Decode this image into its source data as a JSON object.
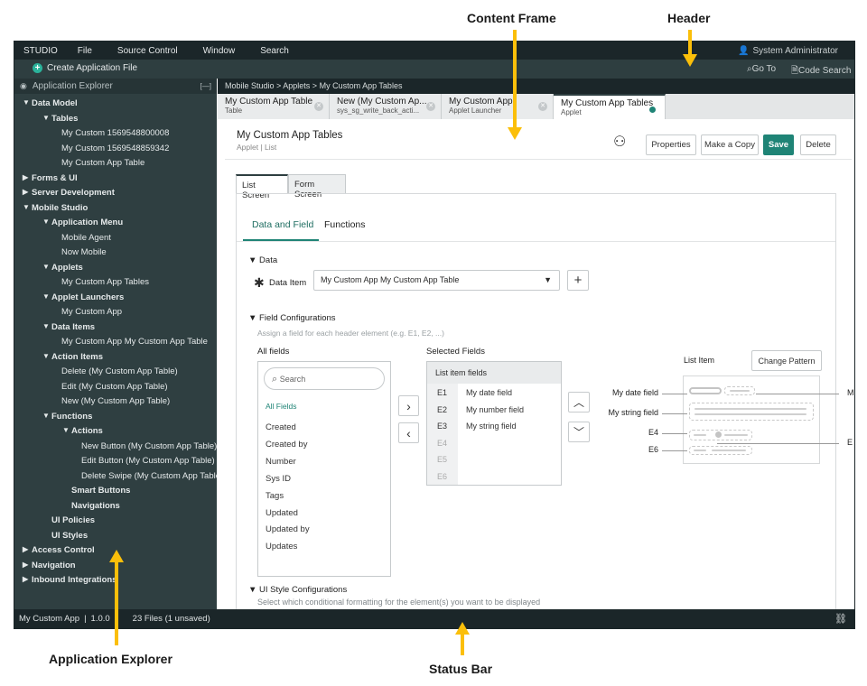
{
  "annotations": {
    "content_frame": "Content Frame",
    "header": "Header",
    "application_explorer": "Application Explorer",
    "status_bar": "Status Bar"
  },
  "menu": {
    "items": [
      "STUDIO",
      "File",
      "Source Control",
      "Window",
      "Search"
    ],
    "user": "System Administrator",
    "create": "Create Application File",
    "goto": "Go To",
    "code_search": "Code Search"
  },
  "explorer": {
    "title": "Application Explorer",
    "collapse": "[—]",
    "items": [
      {
        "label": "Data Model",
        "depth": 0,
        "arrow": "open",
        "bold": true
      },
      {
        "label": "Tables",
        "depth": 2,
        "arrow": "open",
        "bold": true
      },
      {
        "label": "My Custom 1569548800008",
        "depth": 3
      },
      {
        "label": "My Custom 1569548859342",
        "depth": 3
      },
      {
        "label": "My Custom App Table",
        "depth": 3
      },
      {
        "label": "Forms & UI",
        "depth": 0,
        "arrow": "closed",
        "bold": true
      },
      {
        "label": "Server Development",
        "depth": 0,
        "arrow": "closed",
        "bold": true
      },
      {
        "label": "Mobile Studio",
        "depth": 0,
        "arrow": "open",
        "bold": true
      },
      {
        "label": "Application Menu",
        "depth": 2,
        "arrow": "open",
        "bold": true
      },
      {
        "label": "Mobile Agent",
        "depth": 3
      },
      {
        "label": "Now Mobile",
        "depth": 3
      },
      {
        "label": "Applets",
        "depth": 2,
        "arrow": "open",
        "bold": true
      },
      {
        "label": "My Custom App Tables",
        "depth": 3
      },
      {
        "label": "Applet Launchers",
        "depth": 2,
        "arrow": "open",
        "bold": true
      },
      {
        "label": "My Custom App",
        "depth": 3
      },
      {
        "label": "Data Items",
        "depth": 2,
        "arrow": "open",
        "bold": true
      },
      {
        "label": "My Custom App My Custom App Table",
        "depth": 3
      },
      {
        "label": "Action Items",
        "depth": 2,
        "arrow": "open",
        "bold": true
      },
      {
        "label": "Delete (My Custom App Table)",
        "depth": 3
      },
      {
        "label": "Edit (My Custom App Table)",
        "depth": 3
      },
      {
        "label": "New (My Custom App Table)",
        "depth": 3
      },
      {
        "label": "Functions",
        "depth": 2,
        "arrow": "open",
        "bold": true
      },
      {
        "label": "Actions",
        "depth": 4,
        "arrow": "open",
        "bold": true
      },
      {
        "label": "New Button (My Custom App Table)",
        "depth": 5
      },
      {
        "label": "Edit Button (My Custom App Table)",
        "depth": 5
      },
      {
        "label": "Delete Swipe (My Custom App Table)",
        "depth": 5
      },
      {
        "label": "Smart Buttons",
        "depth": 4,
        "bold": true
      },
      {
        "label": "Navigations",
        "depth": 4,
        "bold": true
      },
      {
        "label": "UI Policies",
        "depth": 2,
        "bold": true
      },
      {
        "label": "UI Styles",
        "depth": 2,
        "bold": true
      },
      {
        "label": "Access Control",
        "depth": 0,
        "arrow": "closed",
        "bold": true
      },
      {
        "label": "Navigation",
        "depth": 0,
        "arrow": "closed",
        "bold": true
      },
      {
        "label": "Inbound Integrations",
        "depth": 0,
        "arrow": "closed",
        "bold": true
      }
    ]
  },
  "breadcrumb": "Mobile Studio > Applets > My Custom App Tables",
  "tabs": [
    {
      "title": "My Custom App Table",
      "sub": "Table"
    },
    {
      "title": "New (My Custom Ap...",
      "sub": "sys_sg_write_back_acti..."
    },
    {
      "title": "My Custom App",
      "sub": "Applet Launcher"
    },
    {
      "title": "My Custom App Tables",
      "sub": "Applet"
    }
  ],
  "page": {
    "title": "My Custom App Tables",
    "subtitle": "Applet | List",
    "properties": "Properties",
    "copy": "Make a Copy",
    "save": "Save",
    "delete": "Delete"
  },
  "screen_tabs": [
    "List Screen",
    "Form Screen"
  ],
  "sub_tabs": [
    "Data and Field",
    "Functions"
  ],
  "data_section": {
    "title": "Data",
    "label": "Data Item",
    "value": "My Custom App My Custom App Table",
    "add": "+"
  },
  "field_config": {
    "title": "Field Configurations",
    "hint": "Assign a field for each header element (e.g. E1, E2, ...)",
    "all_label": "All fields",
    "selected_label": "Selected Fields",
    "search_placeholder": "Search",
    "all_fields_link": "All Fields",
    "all_fields": [
      "Created",
      "Created by",
      "Number",
      "Sys ID",
      "Tags",
      "Updated",
      "Updated by",
      "Updates"
    ],
    "list_header": "List item fields",
    "selected": [
      {
        "el": "E1",
        "field": "My date field"
      },
      {
        "el": "E2",
        "field": "My number field"
      },
      {
        "el": "E3",
        "field": "My string field"
      },
      {
        "el": "E4",
        "field": ""
      },
      {
        "el": "E5",
        "field": ""
      },
      {
        "el": "E6",
        "field": ""
      }
    ],
    "preview_label": "List Item",
    "change_pattern": "Change Pattern",
    "preview_left": [
      "My date field",
      "My string field",
      "E4",
      "E6"
    ],
    "preview_right": [
      "M",
      "E"
    ]
  },
  "ui_style": {
    "title": "UI Style Configurations",
    "hint": "Select which conditional formatting for the element(s) you want to be displayed"
  },
  "status": {
    "app": "My Custom App",
    "version": "1.0.0",
    "files": "23 Files (1 unsaved)"
  },
  "colors": {
    "accent": "#1f8476",
    "header": "#1b2629",
    "sidebar": "#2f3f41",
    "annotation": "#fbbf0a"
  }
}
